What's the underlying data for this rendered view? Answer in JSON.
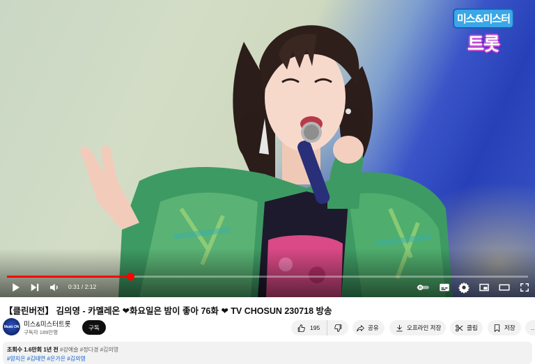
{
  "player": {
    "logo": {
      "top": "미스&미스터",
      "bottom": "트롯"
    },
    "progress_fraction": 0.2371,
    "time_current": "0:31",
    "time_separator": " / ",
    "time_duration": "2:12",
    "accent_color": "#ff0000"
  },
  "video": {
    "title": "【클린버전】 김의영 - 카멜레온 ❤화요일은 밤이 좋아 76화 ❤ TV CHOSUN 230718 방송"
  },
  "channel": {
    "avatar_text": "Music ON",
    "name": "미스&미스터트롯",
    "subscribers": "구독자 189만명",
    "subscribe_label": "구독"
  },
  "actions": {
    "like_count": "195",
    "share_label": "공유",
    "offline_label": "오프라인 저장",
    "clip_label": "클립",
    "save_label": "저장",
    "more_label": "…"
  },
  "description": {
    "views": "조회수 1.6만회",
    "age": "1년 전",
    "tags_line1": [
      "#강예슬",
      "#정다경",
      "#김의영"
    ],
    "tags_line2": [
      "#양지은",
      "#김태연",
      "#은가은",
      "#김의영"
    ],
    "tag_color": "#065fd4"
  },
  "icons": [
    "play-icon",
    "next-icon",
    "volume-icon",
    "autoplay-toggle-icon",
    "subtitles-icon",
    "settings-gear-icon",
    "miniplayer-icon",
    "theater-mode-icon",
    "fullscreen-icon",
    "thumbs-up-icon",
    "thumbs-down-icon",
    "share-icon",
    "download-icon",
    "scissors-icon",
    "save-playlist-icon",
    "more-icon"
  ]
}
